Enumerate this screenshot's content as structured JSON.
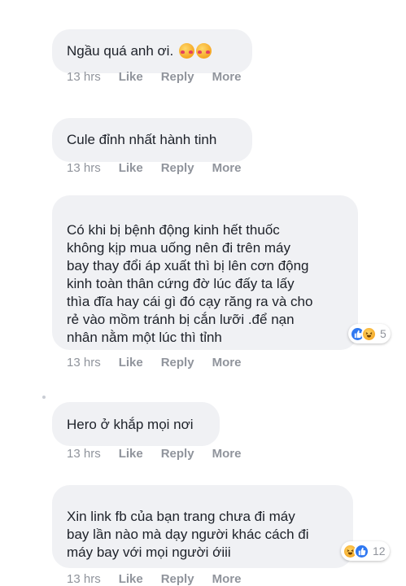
{
  "comments": [
    {
      "text": "Ngầu quá anh ơi.",
      "emoji": [
        "smiling-face-with-hearts",
        "smiling-face-with-hearts"
      ],
      "time": "13 hrs",
      "like": "Like",
      "reply": "Reply",
      "more": "More"
    },
    {
      "text": "Cule đỉnh nhất hành tinh",
      "time": "13 hrs",
      "like": "Like",
      "reply": "Reply",
      "more": "More"
    },
    {
      "text": "Có khi bị bệnh động kinh hết thuốc\nkhông kịp mua uống nên đi trên máy\nbay thay đổi áp xuất thì bị lên cơn động\nkinh toàn thân cứng đờ lúc đấy ta lấy\nthìa đĩa hay cái gì đó cạy răng ra và cho\nrẻ vào mồm tránh bị cắn lưỡi .để nạn\nnhân nằm một lúc thì tỉnh",
      "time": "13 hrs",
      "like": "Like",
      "reply": "Reply",
      "more": "More",
      "reaction_icons": [
        "like-icon",
        "haha-icon"
      ],
      "reaction_count": "5"
    },
    {
      "text": "Hero ở khắp mọi nơi",
      "time": "13 hrs",
      "like": "Like",
      "reply": "Reply",
      "more": "More"
    },
    {
      "text": "Xin link fb của bạn trang chưa đi máy\nbay lần nào mà dạy người khác cách đi\nmáy bay với mọi người ớiii",
      "time": "13 hrs",
      "like": "Like",
      "reply": "Reply",
      "more": "More",
      "reaction_icons": [
        "haha-icon",
        "like-icon"
      ],
      "reaction_count": "12"
    }
  ],
  "colors": {
    "bubble": "#f0f1f4",
    "meta_text": "#90949c",
    "like_blue": "#2f78f1",
    "haha_yellow": "#f5a623"
  }
}
